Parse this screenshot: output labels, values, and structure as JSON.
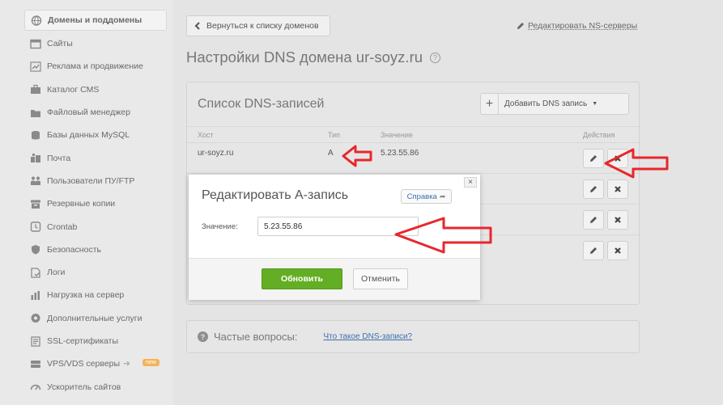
{
  "sidebar": {
    "items": [
      {
        "label": "Домены и поддомены",
        "icon": "globe-icon",
        "active": true
      },
      {
        "label": "Сайты",
        "icon": "window-icon"
      },
      {
        "label": "Реклама и продвижение",
        "icon": "chart-icon"
      },
      {
        "label": "Каталог CMS",
        "icon": "briefcase-icon"
      },
      {
        "label": "Файловый менеджер",
        "icon": "folder-icon"
      },
      {
        "label": "Базы данных MySQL",
        "icon": "database-icon"
      },
      {
        "label": "Почта",
        "icon": "mailbox-icon"
      },
      {
        "label": "Пользователи ПУ/FTP",
        "icon": "users-icon"
      },
      {
        "label": "Резервные копии",
        "icon": "archive-icon"
      },
      {
        "label": "Crontab",
        "icon": "clock-icon"
      },
      {
        "label": "Безопасность",
        "icon": "shield-icon"
      },
      {
        "label": "Логи",
        "icon": "log-icon"
      },
      {
        "label": "Нагрузка на сервер",
        "icon": "bar-chart-icon"
      },
      {
        "label": "Дополнительные услуги",
        "icon": "gear-icon"
      },
      {
        "label": "SSL-сертификаты",
        "icon": "certificate-icon"
      },
      {
        "label": "VPS/VDS серверы",
        "icon": "server-icon",
        "badge": "new",
        "arrow": "➜"
      },
      {
        "label": "Ускоритель сайтов",
        "icon": "speedometer-icon"
      }
    ]
  },
  "header": {
    "back_label": "Вернуться к списку доменов",
    "ns_label": "Редактировать NS-серверы",
    "title": "Настройки DNS домена ur-soyz.ru",
    "help_glyph": "?"
  },
  "dns_panel": {
    "title": "Список DNS-записей",
    "add_label": "Добавить DNS запись",
    "add_caret": "▼",
    "columns": {
      "host": "Хост",
      "type": "Тип",
      "value": "Значение",
      "actions": "Действия"
    },
    "rows": [
      {
        "host": "ur-soyz.ru",
        "type": "A",
        "value": "5.23.55.86"
      },
      {
        "host": "",
        "type": "",
        "value": ""
      },
      {
        "host": "",
        "type": "",
        "value": ""
      },
      {
        "host": "",
        "type": "",
        "value": ""
      }
    ]
  },
  "faq": {
    "title": "Частые вопросы:",
    "link": "Что такое DNS-записи?"
  },
  "modal": {
    "title": "Редактировать А-запись",
    "help_label": "Справка",
    "field_label": "Значение:",
    "field_value": "5.23.55.86",
    "update_label": "Обновить",
    "cancel_label": "Отменить",
    "close_glyph": "×"
  },
  "colors": {
    "accent_green": "#63ae24",
    "annotation_red": "#e8262b",
    "link_blue": "#3b6fb0"
  }
}
